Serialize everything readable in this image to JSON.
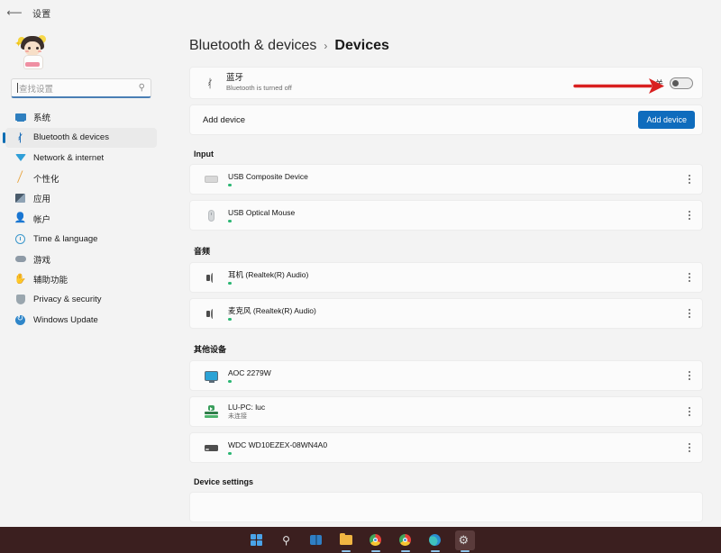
{
  "window": {
    "back_icon": "back-arrow-icon",
    "title": "设置"
  },
  "sidebar": {
    "avatar": "user-avatar",
    "search": {
      "placeholder": "查找设置",
      "value": "",
      "icon": "search-icon"
    },
    "items": [
      {
        "label": "系统",
        "icon": "system-icon",
        "selected": false
      },
      {
        "label": "Bluetooth & devices",
        "icon": "bluetooth-icon",
        "selected": true
      },
      {
        "label": "Network & internet",
        "icon": "network-icon",
        "selected": false
      },
      {
        "label": "个性化",
        "icon": "personalization-icon",
        "selected": false
      },
      {
        "label": "应用",
        "icon": "apps-icon",
        "selected": false
      },
      {
        "label": "帐户",
        "icon": "accounts-icon",
        "selected": false
      },
      {
        "label": "Time & language",
        "icon": "time-language-icon",
        "selected": false
      },
      {
        "label": "游戏",
        "icon": "gaming-icon",
        "selected": false
      },
      {
        "label": "辅助功能",
        "icon": "accessibility-icon",
        "selected": false
      },
      {
        "label": "Privacy & security",
        "icon": "privacy-security-icon",
        "selected": false
      },
      {
        "label": "Windows Update",
        "icon": "windows-update-icon",
        "selected": false
      }
    ]
  },
  "breadcrumb": {
    "parent": "Bluetooth & devices",
    "separator": "›",
    "current": "Devices"
  },
  "bluetooth_card": {
    "icon": "bluetooth-icon",
    "title": "蓝牙",
    "subtitle": "Bluetooth is turned off",
    "toggle_label": "关",
    "toggle_state": "off"
  },
  "add_device": {
    "label": "Add device",
    "button_label": "Add device",
    "accent_color": "#0f6cbd"
  },
  "sections": [
    {
      "title": "Input",
      "devices": [
        {
          "name": "USB Composite Device",
          "subtitle": "",
          "icon": "keyboard-icon",
          "status": "connected",
          "menu_icon": "more-options-icon"
        },
        {
          "name": "USB Optical Mouse",
          "subtitle": "",
          "icon": "mouse-icon",
          "status": "connected",
          "menu_icon": "more-options-icon"
        }
      ]
    },
    {
      "title": "音频",
      "devices": [
        {
          "name": "耳机 (Realtek(R) Audio)",
          "subtitle": "",
          "icon": "speaker-icon",
          "status": "connected",
          "menu_icon": "more-options-icon"
        },
        {
          "name": "麦克风 (Realtek(R) Audio)",
          "subtitle": "",
          "icon": "microphone-icon",
          "status": "connected",
          "menu_icon": "more-options-icon"
        }
      ]
    },
    {
      "title": "其他设备",
      "devices": [
        {
          "name": "AOC 2279W",
          "subtitle": "",
          "icon": "monitor-icon",
          "status": "connected",
          "menu_icon": "more-options-icon"
        },
        {
          "name": "LU-PC: luc",
          "subtitle": "未连接",
          "icon": "media-device-icon",
          "status": "disconnected",
          "menu_icon": "more-options-icon"
        },
        {
          "name": "WDC WD10EZEX-08WN4A0",
          "subtitle": "",
          "icon": "disk-drive-icon",
          "status": "connected",
          "menu_icon": "more-options-icon"
        }
      ]
    }
  ],
  "device_settings": {
    "title": "Device settings"
  },
  "annotation": {
    "type": "arrow",
    "color": "#d92020",
    "points_to": "bluetooth-toggle"
  },
  "status_colors": {
    "connected": "#2bb673",
    "disconnected": "transparent"
  },
  "taskbar": {
    "items": [
      {
        "icon": "start-windows-icon",
        "active": false,
        "running": false
      },
      {
        "icon": "search-icon",
        "active": false,
        "running": false
      },
      {
        "icon": "task-view-icon",
        "active": false,
        "running": false
      },
      {
        "icon": "file-explorer-icon",
        "active": false,
        "running": true
      },
      {
        "icon": "chrome-icon",
        "active": false,
        "running": true
      },
      {
        "icon": "chrome-browser-icon",
        "active": false,
        "running": true
      },
      {
        "icon": "edge-icon",
        "active": false,
        "running": true
      },
      {
        "icon": "settings-gear-icon",
        "active": true,
        "running": true
      }
    ]
  }
}
